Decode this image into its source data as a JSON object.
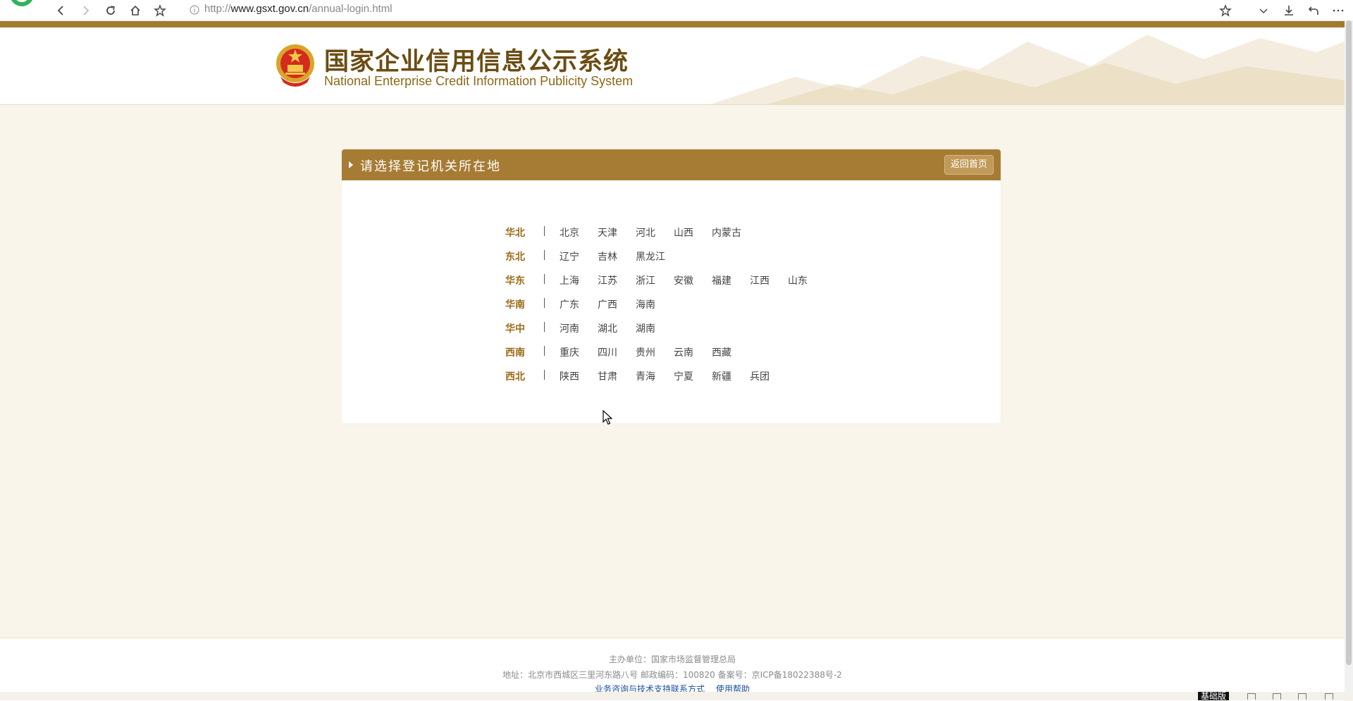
{
  "browser": {
    "url_protocol": "http://",
    "url_host": "www.gsxt.gov.cn",
    "url_path": "/annual-login.html"
  },
  "header": {
    "title_cn": "国家企业信用信息公示系统",
    "title_en": "National Enterprise Credit Information Publicity System"
  },
  "panel": {
    "title": "请选择登记机关所在地",
    "back_home": "返回首页"
  },
  "regions": [
    {
      "name": "华北",
      "provinces": [
        "北京",
        "天津",
        "河北",
        "山西",
        "内蒙古"
      ]
    },
    {
      "name": "东北",
      "provinces": [
        "辽宁",
        "吉林",
        "黑龙江"
      ]
    },
    {
      "name": "华东",
      "provinces": [
        "上海",
        "江苏",
        "浙江",
        "安徽",
        "福建",
        "江西",
        "山东"
      ]
    },
    {
      "name": "华南",
      "provinces": [
        "广东",
        "广西",
        "海南"
      ]
    },
    {
      "name": "华中",
      "provinces": [
        "河南",
        "湖北",
        "湖南"
      ]
    },
    {
      "name": "西南",
      "provinces": [
        "重庆",
        "四川",
        "贵州",
        "云南",
        "西藏"
      ]
    },
    {
      "name": "西北",
      "provinces": [
        "陕西",
        "甘肃",
        "青海",
        "宁夏",
        "新疆",
        "兵团"
      ]
    }
  ],
  "footer": {
    "sponsor": "主办单位：国家市场监督管理总局",
    "address": "地址：北京市西城区三里河东路八号   邮政编码：100820   备案号：京ICP备18022388号-2",
    "link_support": "业务咨询与技术支持联系方式",
    "link_help": "使用帮助"
  },
  "taskbar": {
    "ime_label": "基础版"
  },
  "colors": {
    "gold": "#a67c34",
    "region_text": "#9b6b18",
    "page_bg": "#f9f5eb"
  }
}
